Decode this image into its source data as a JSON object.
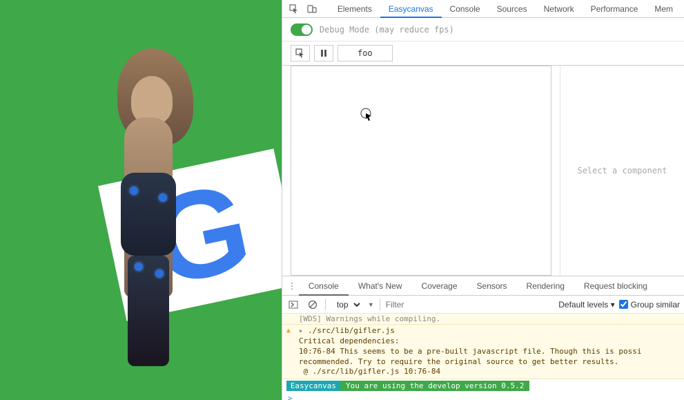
{
  "devtools": {
    "tabs": [
      "Elements",
      "Easycanvas",
      "Console",
      "Sources",
      "Network",
      "Performance",
      "Mem"
    ],
    "active_tab": "Easycanvas",
    "debug_mode_label": "Debug Mode (may reduce fps)",
    "controls": {
      "item_label": "foo"
    },
    "side_placeholder": "Select a component"
  },
  "drawer": {
    "tabs": [
      "Console",
      "What's New",
      "Coverage",
      "Sensors",
      "Rendering",
      "Request blocking"
    ],
    "active_tab": "Console",
    "context": "top",
    "filter_placeholder": "Filter",
    "levels_label": "Default levels ▾",
    "group_similar_label": "Group similar",
    "group_similar_checked": true
  },
  "console": {
    "wds_line": "[WDS] Warnings while compiling.",
    "warn_file": "./src/lib/gifler.js",
    "warn_title": "Critical dependencies:",
    "warn_body": "10:76-84 This seems to be a pre-built javascript file. Though this is possi recommended. Try to require the original source to get better results.",
    "warn_at": " @ ./src/lib/gifler.js 10:76-84",
    "info_badge": "Easycanvas",
    "info_msg": " You are using the develop version 0.5.2 ",
    "prompt": ">"
  },
  "canvas": {
    "logo_letter": "G"
  }
}
